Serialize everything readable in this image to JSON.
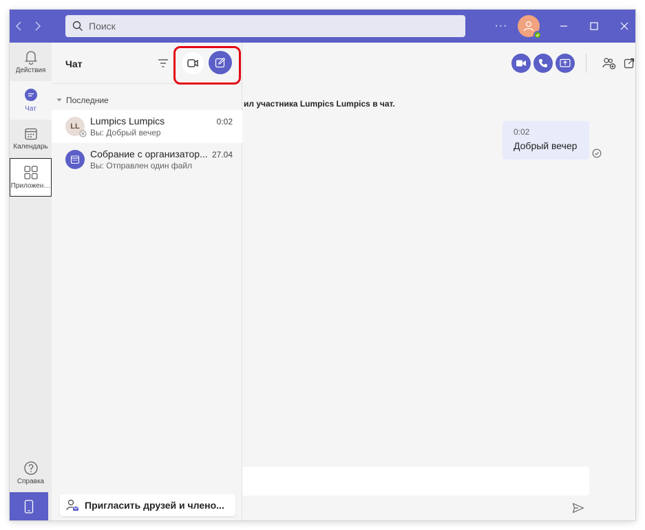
{
  "titlebar": {
    "search_placeholder": "Поиск",
    "more_label": "···",
    "accent_color": "#5b5fc7"
  },
  "rail": {
    "items": [
      {
        "label": "Действия",
        "icon": "bell-icon"
      },
      {
        "label": "Чат",
        "icon": "chat-icon"
      },
      {
        "label": "Календарь",
        "icon": "calendar-icon"
      },
      {
        "label": "Приложения",
        "display_label": "Приложен…",
        "icon": "apps-icon"
      },
      {
        "label": "Справка",
        "icon": "help-icon"
      }
    ],
    "bottom_icon": "mobile-icon"
  },
  "chat_list": {
    "title": "Чат",
    "section_label": "Последние",
    "chats": [
      {
        "initials": "LL",
        "name": "Lumpics Lumpics",
        "preview": "Вы: Добрый вечер",
        "time": "0:02"
      },
      {
        "name": "Собрание с организатор...",
        "preview": "Вы: Отправлен один файл",
        "time": "27.04"
      }
    ],
    "invite_label": "Пригласить друзей и члено..."
  },
  "conversation": {
    "system_message": "ил участника Lumpics Lumpics в чат.",
    "message": {
      "time": "0:02",
      "text": "Добрый вечер"
    },
    "composer_placeholder": ""
  }
}
